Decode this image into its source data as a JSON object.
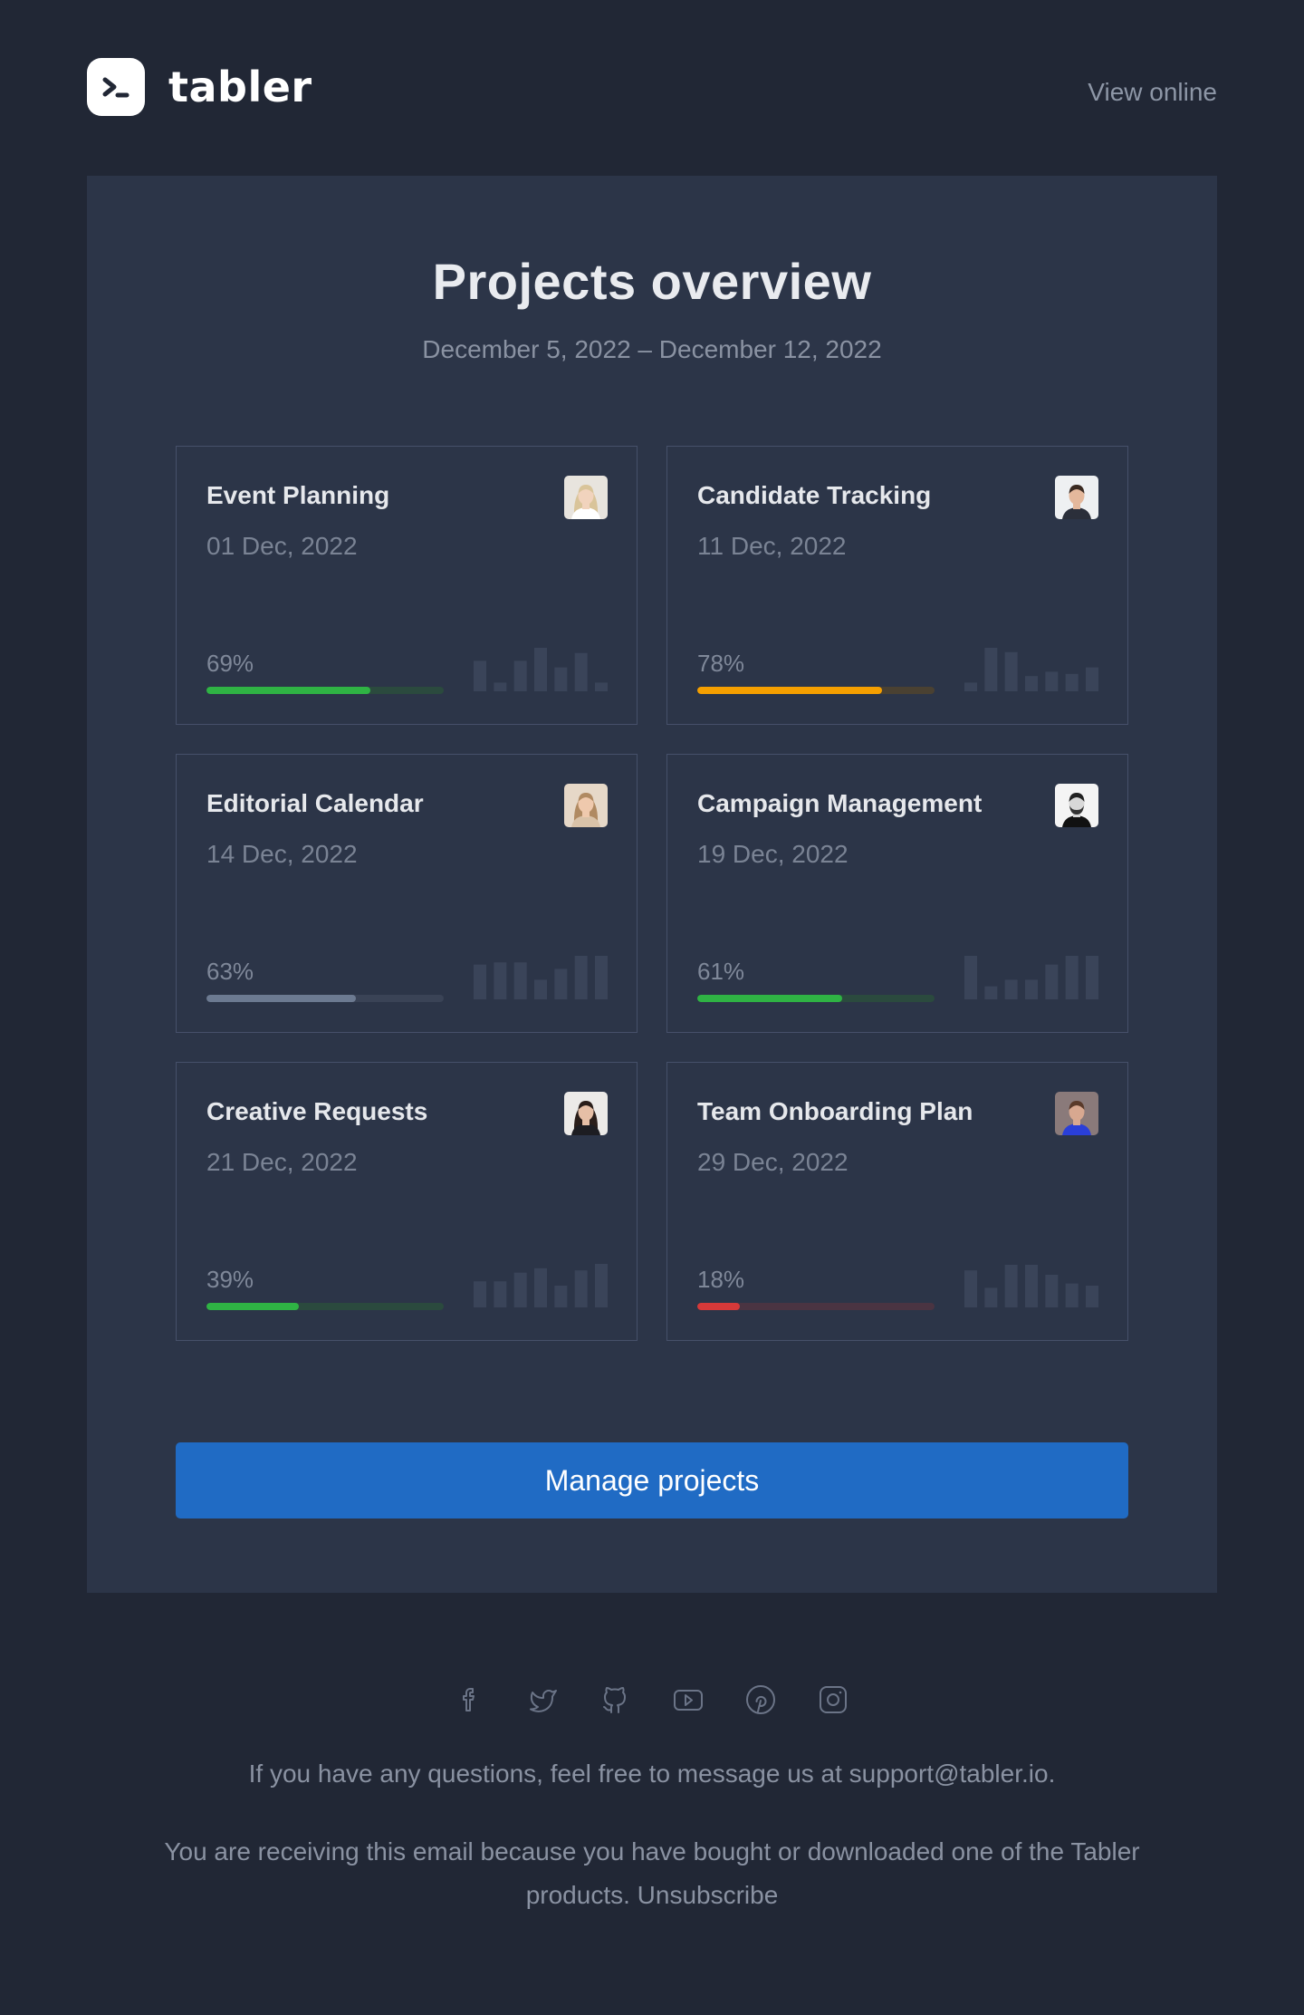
{
  "brand": {
    "name": "tabler"
  },
  "header": {
    "view_online": "View online"
  },
  "main": {
    "title": "Projects overview",
    "subtitle": "December 5, 2022 – December 12, 2022",
    "button": "Manage projects"
  },
  "colors": {
    "background": "#212735",
    "panel": "#2c3548",
    "primary": "#206bc4",
    "success": "#2fb344",
    "warning": "#f59f00",
    "secondary": "#6c7a91",
    "danger": "#d63939"
  },
  "projects": [
    {
      "name": "Event Planning",
      "date": "01 Dec, 2022",
      "percent_label": "69%",
      "progress": 0.69,
      "progress_color": "#2fb344",
      "track_color": "#2b4a3e",
      "bars": [
        0.7,
        0.2,
        0.7,
        1.0,
        0.55,
        0.88,
        0.2
      ],
      "avatar_icon": "avatar-woman-blonde"
    },
    {
      "name": "Candidate Tracking",
      "date": "11 Dec, 2022",
      "percent_label": "78%",
      "progress": 0.78,
      "progress_color": "#f59f00",
      "track_color": "#4a4132",
      "bars": [
        0.2,
        1.0,
        0.9,
        0.35,
        0.45,
        0.4,
        0.55
      ],
      "avatar_icon": "avatar-man-dark-hair"
    },
    {
      "name": "Editorial Calendar",
      "date": "14 Dec, 2022",
      "percent_label": "63%",
      "progress": 0.63,
      "progress_color": "#6c7a91",
      "track_color": "#3a4356",
      "bars": [
        0.8,
        0.85,
        0.85,
        0.45,
        0.7,
        1.0,
        1.0
      ],
      "avatar_icon": "avatar-woman-long-hair"
    },
    {
      "name": "Campaign Management",
      "date": "19 Dec, 2022",
      "percent_label": "61%",
      "progress": 0.61,
      "progress_color": "#2fb344",
      "track_color": "#2b4a3e",
      "bars": [
        1.0,
        0.3,
        0.45,
        0.45,
        0.8,
        1.0,
        1.0
      ],
      "avatar_icon": "avatar-man-beard"
    },
    {
      "name": "Creative Requests",
      "date": "21 Dec, 2022",
      "percent_label": "39%",
      "progress": 0.39,
      "progress_color": "#2fb344",
      "track_color": "#2b4a3e",
      "bars": [
        0.6,
        0.6,
        0.8,
        0.9,
        0.5,
        0.85,
        1.0
      ],
      "avatar_icon": "avatar-woman-dark-hair"
    },
    {
      "name": "Team Onboarding Plan",
      "date": "29 Dec, 2022",
      "percent_label": "18%",
      "progress": 0.18,
      "progress_color": "#d63939",
      "track_color": "#4a3442",
      "bars": [
        0.85,
        0.45,
        0.98,
        0.98,
        0.75,
        0.55,
        0.5
      ],
      "avatar_icon": "avatar-man-glasses"
    }
  ],
  "social": [
    {
      "icon": "facebook-icon"
    },
    {
      "icon": "twitter-icon"
    },
    {
      "icon": "github-icon"
    },
    {
      "icon": "youtube-icon"
    },
    {
      "icon": "pinterest-icon"
    },
    {
      "icon": "instagram-icon"
    }
  ],
  "footer": {
    "questions": "If you have any questions, feel free to message us at support@tabler.io.",
    "legal_text": "You are receiving this email because you have bought or downloaded one of the Tabler products.",
    "unsubscribe": "Unsubscribe"
  }
}
